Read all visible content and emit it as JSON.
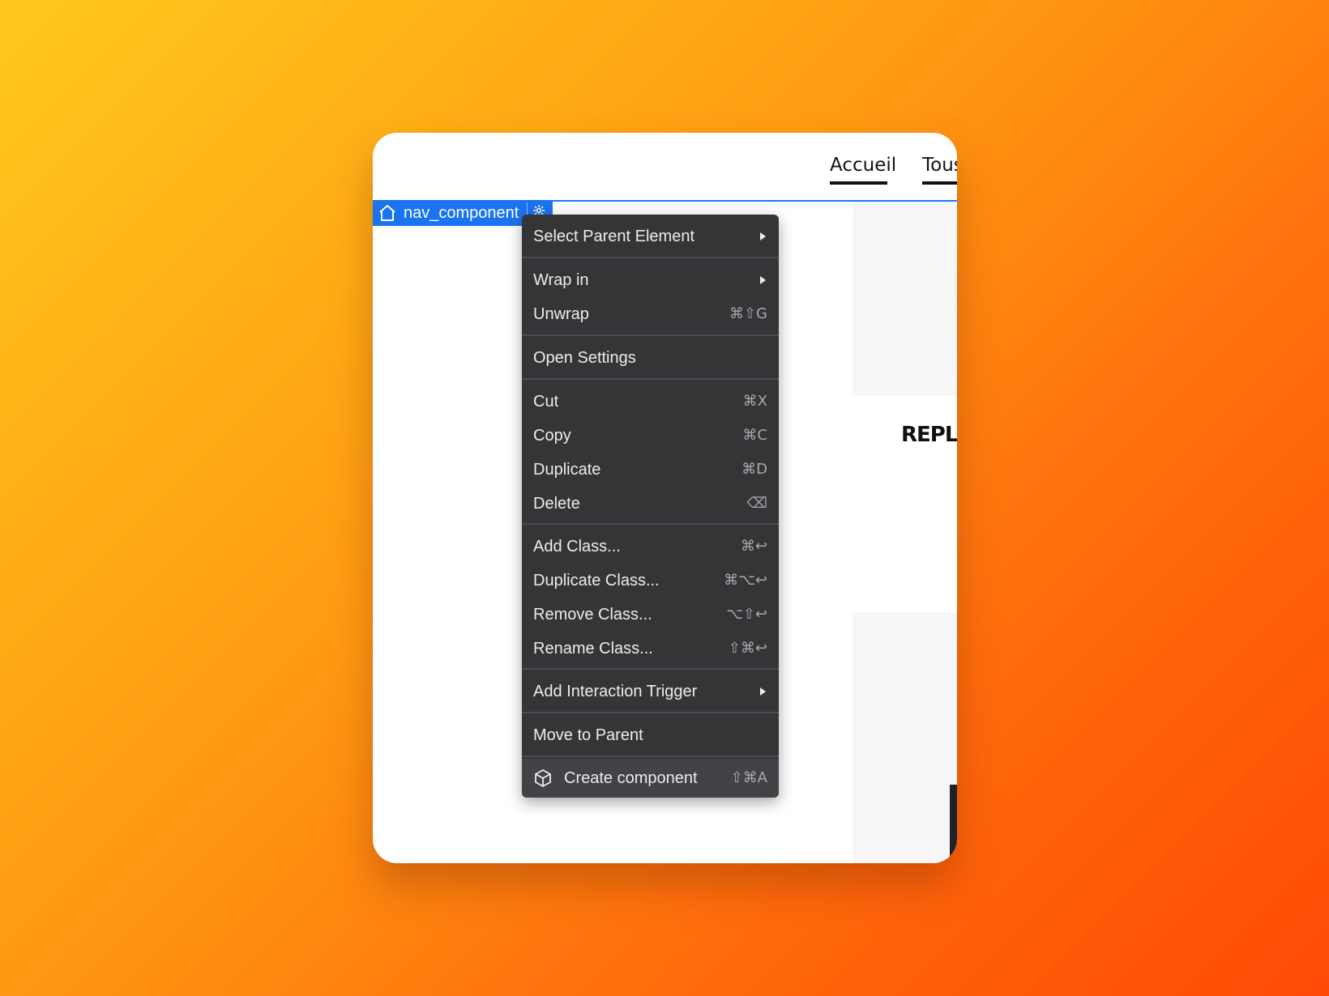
{
  "nav": {
    "links": [
      "Accueil",
      "Tous"
    ]
  },
  "canvas": {
    "headline_fragment": "REPLA"
  },
  "selection": {
    "label": "nav_component",
    "color": "#1a73f0"
  },
  "context_menu": {
    "select_parent": {
      "label": "Select Parent Element"
    },
    "wrap_in": {
      "label": "Wrap in"
    },
    "unwrap": {
      "label": "Unwrap",
      "shortcut": "⌘⇧G"
    },
    "open_settings": {
      "label": "Open Settings"
    },
    "cut": {
      "label": "Cut",
      "shortcut": "⌘X"
    },
    "copy": {
      "label": "Copy",
      "shortcut": "⌘C"
    },
    "duplicate": {
      "label": "Duplicate",
      "shortcut": "⌘D"
    },
    "delete": {
      "label": "Delete",
      "shortcut": "⌫"
    },
    "add_class": {
      "label": "Add Class...",
      "shortcut": "⌘↩"
    },
    "duplicate_class": {
      "label": "Duplicate Class...",
      "shortcut": "⌘⌥↩"
    },
    "remove_class": {
      "label": "Remove Class...",
      "shortcut": "⌥⇧↩"
    },
    "rename_class": {
      "label": "Rename Class...",
      "shortcut": "⇧⌘↩"
    },
    "add_interaction_trigger": {
      "label": "Add Interaction Trigger"
    },
    "move_to_parent": {
      "label": "Move to Parent"
    },
    "create_component": {
      "label": "Create component",
      "shortcut": "⇧⌘A"
    }
  },
  "colors": {
    "background_gradient": [
      "#ffc81c",
      "#ff6a0c",
      "#ff4a05"
    ],
    "menu_background": "#353538",
    "selection_accent": "#1e7bff"
  }
}
